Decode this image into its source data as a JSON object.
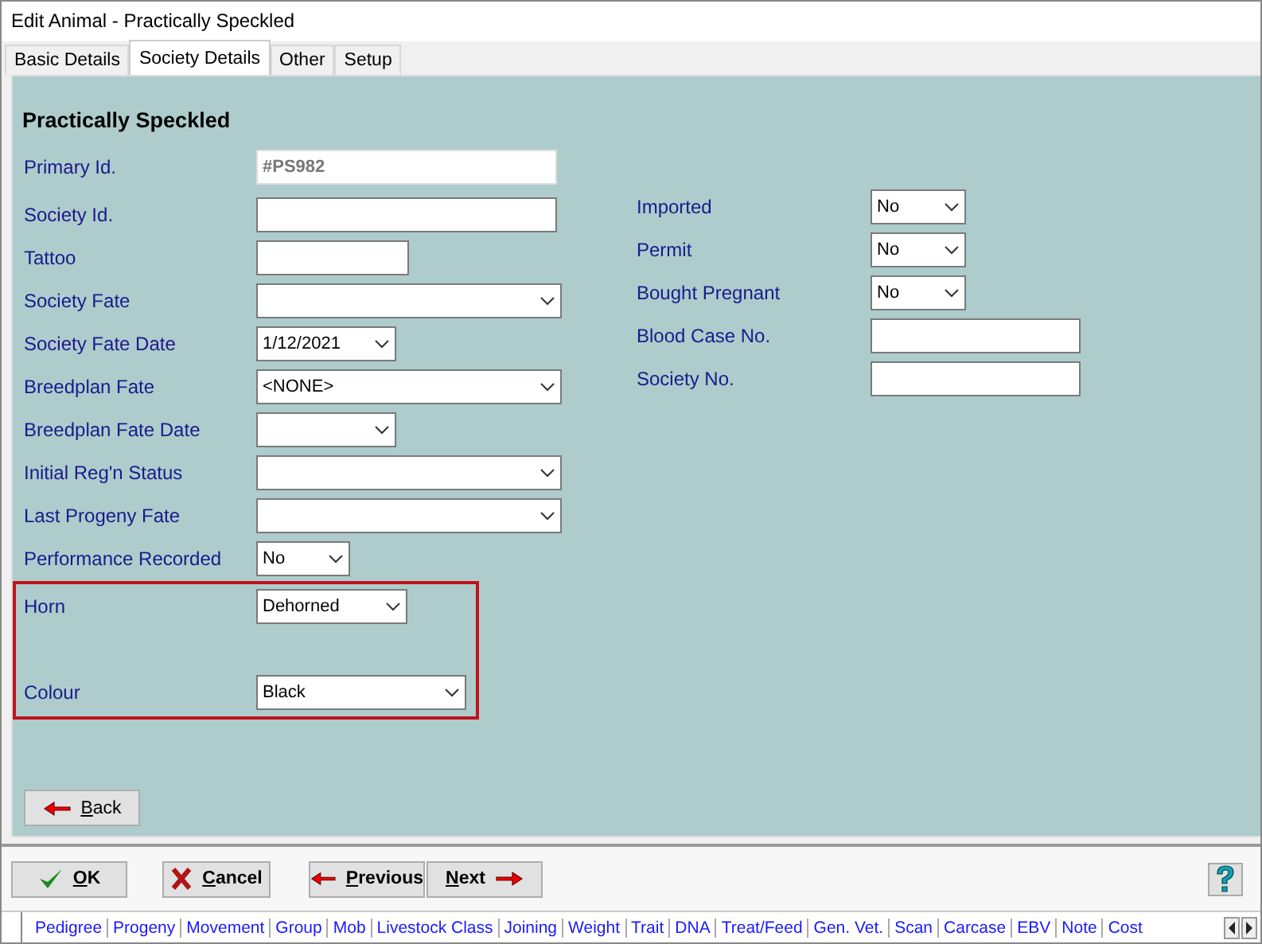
{
  "window": {
    "title": "Edit Animal - Practically Speckled"
  },
  "tabs": [
    {
      "label": "Basic Details",
      "selected": false
    },
    {
      "label": "Society Details",
      "selected": true
    },
    {
      "label": "Other",
      "selected": false
    },
    {
      "label": "Setup",
      "selected": false
    }
  ],
  "heading": "Practically Speckled",
  "left_fields": [
    {
      "label": "Primary Id.",
      "kind": "text",
      "value": "#PS982",
      "disabled": true
    },
    {
      "label": "Society Id.",
      "kind": "text",
      "disabled": false
    },
    {
      "label": "Tattoo",
      "kind": "text",
      "disabled": false
    },
    {
      "label": "Society Fate",
      "kind": "dropdown",
      "disabled": false
    },
    {
      "label": "Society Fate Date",
      "kind": "dropdown",
      "value": "1/12/2021",
      "disabled": false
    },
    {
      "label": "Breedplan Fate",
      "kind": "dropdown",
      "value": "<NONE>",
      "disabled": false
    },
    {
      "label": "Breedplan Fate Date",
      "kind": "dropdown",
      "disabled": false
    },
    {
      "label": "Initial Reg'n Status",
      "kind": "dropdown",
      "disabled": false
    },
    {
      "label": "Last Progeny Fate",
      "kind": "dropdown",
      "disabled": false
    },
    {
      "label": "Performance Recorded",
      "kind": "dropdown",
      "value": "No",
      "disabled": false
    }
  ],
  "highlighted_fields": [
    {
      "label": "Horn",
      "kind": "dropdown",
      "value": "Dehorned",
      "disabled": false
    },
    {
      "label": "Colour",
      "kind": "dropdown",
      "value": "Black",
      "disabled": false
    }
  ],
  "right_fields": [
    {
      "label": "Imported",
      "kind": "dropdown",
      "value": "No",
      "disabled": false
    },
    {
      "label": "Permit",
      "kind": "dropdown",
      "value": "No",
      "disabled": false
    },
    {
      "label": "Bought Pregnant",
      "kind": "dropdown",
      "value": "No",
      "disabled": false
    },
    {
      "label": "Blood Case No.",
      "kind": "text",
      "disabled": false
    },
    {
      "label": "Society No.",
      "kind": "text",
      "disabled": false
    }
  ],
  "back_button": "Back",
  "buttons": [
    {
      "label": "OK",
      "kind": "ok"
    },
    {
      "label": "Cancel",
      "kind": "cancel"
    },
    {
      "label": "Previous",
      "kind": "previous"
    },
    {
      "label": "Next",
      "kind": "next"
    }
  ],
  "links": [
    "Pedigree",
    "Progeny",
    "Movement",
    "Group",
    "Mob",
    "Livestock Class",
    "Joining",
    "Weight",
    "Trait",
    "DNA",
    "Treat/Feed",
    "Gen. Vet.",
    "Scan",
    "Carcase",
    "EBV",
    "Note",
    "Cost"
  ]
}
